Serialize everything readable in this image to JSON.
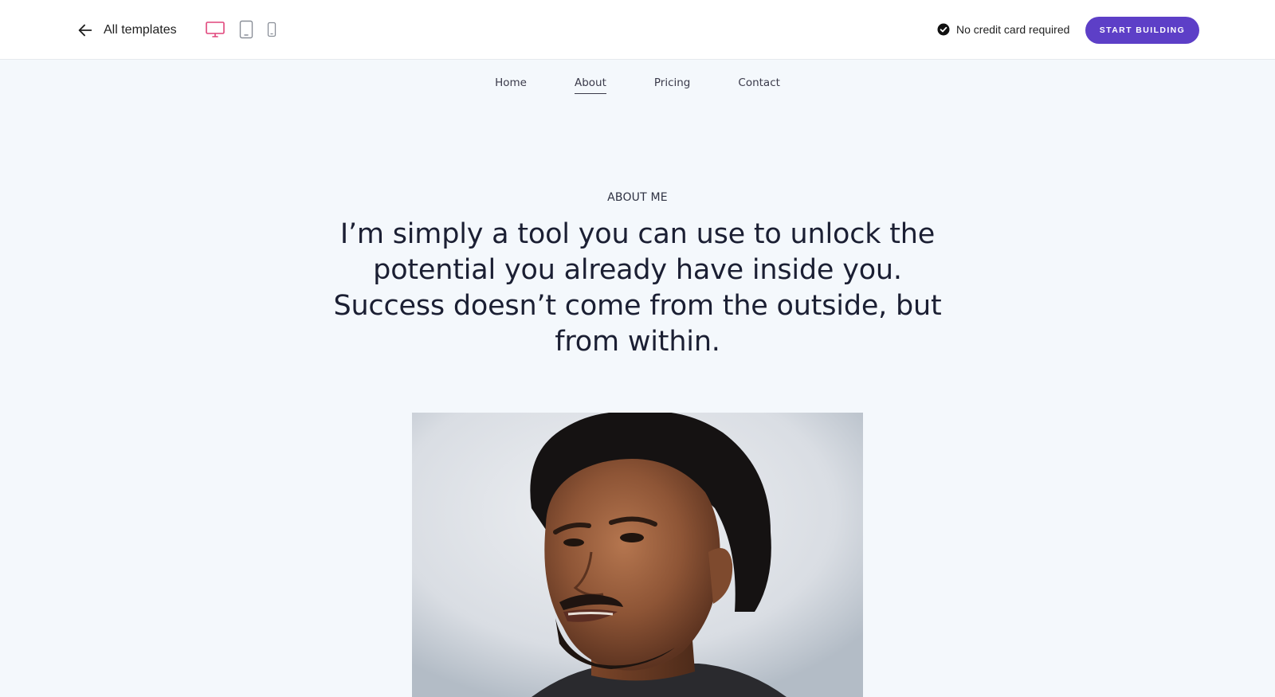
{
  "topbar": {
    "back_label": "All templates",
    "devices": [
      {
        "name": "desktop",
        "active": true
      },
      {
        "name": "tablet",
        "active": false
      },
      {
        "name": "mobile",
        "active": false
      }
    ],
    "badge_text": "No credit card required",
    "cta_label": "START BUILDING",
    "accent_color": "#5d3fc7",
    "active_device_color": "#e0457b"
  },
  "site_nav": {
    "items": [
      {
        "label": "Home",
        "active": false
      },
      {
        "label": "About",
        "active": true
      },
      {
        "label": "Pricing",
        "active": false
      },
      {
        "label": "Contact",
        "active": false
      }
    ]
  },
  "hero": {
    "eyebrow": "ABOUT ME",
    "headline": "I’m simply a tool you can use to unlock the potential you already have inside you. Success doesn’t come from the outside, but from within."
  },
  "icons": {
    "back": "arrow-left-icon",
    "desktop": "desktop-icon",
    "tablet": "tablet-icon",
    "mobile": "mobile-icon",
    "check": "check-circle-icon"
  }
}
